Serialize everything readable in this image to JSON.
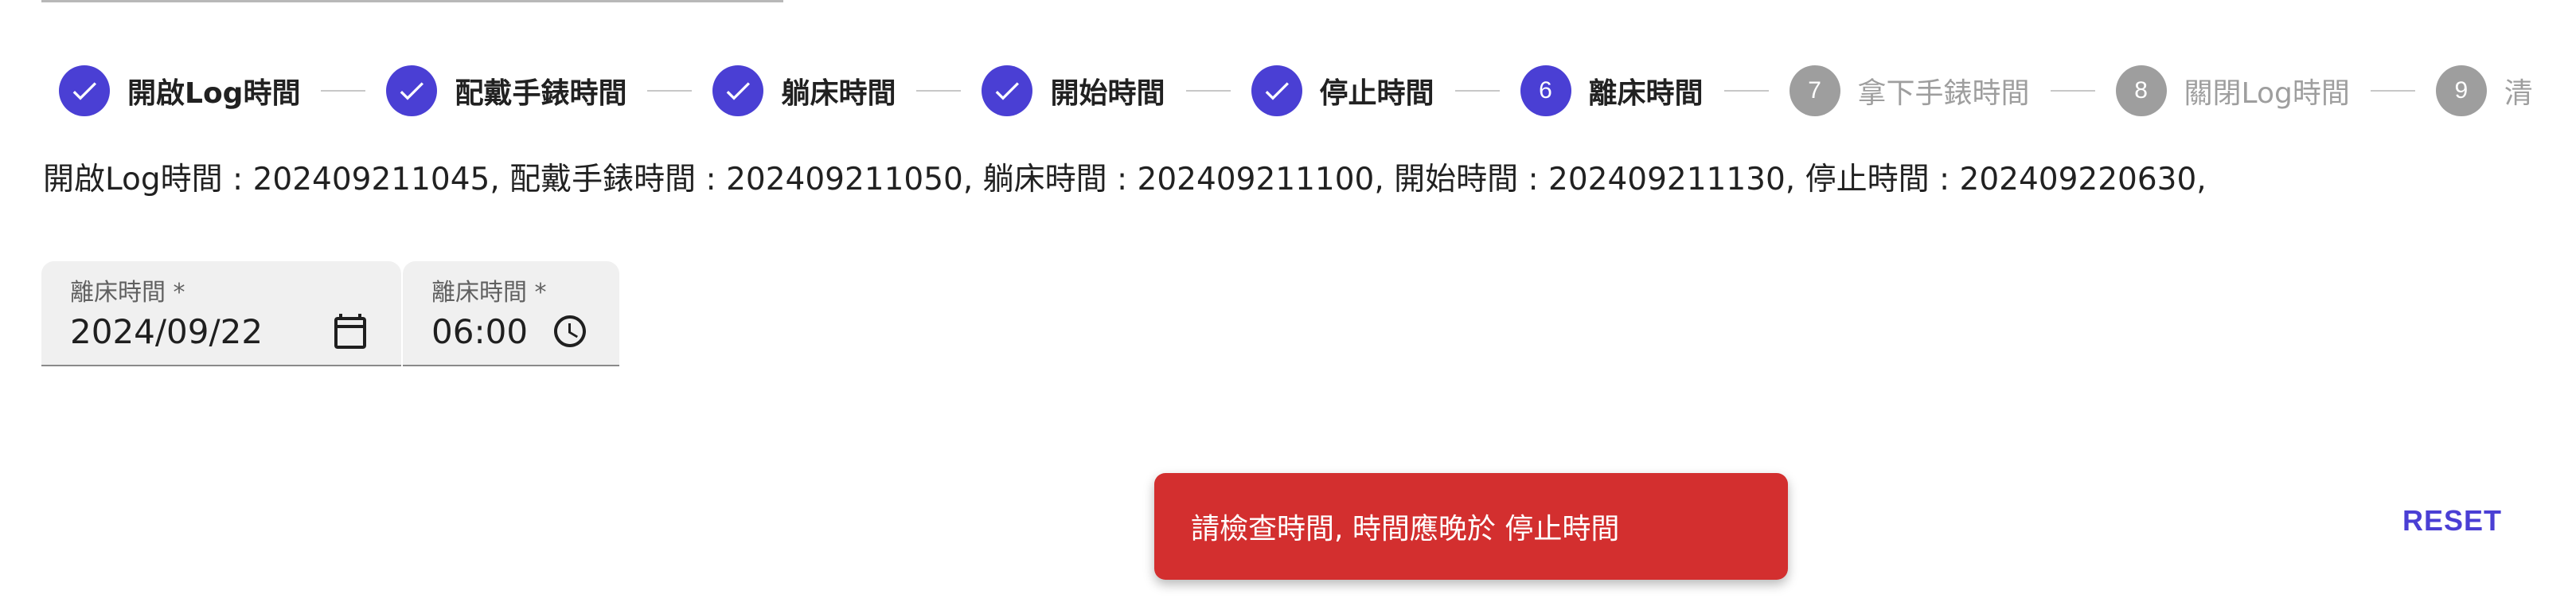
{
  "stepper": {
    "steps": [
      {
        "label": "開啟Log時間",
        "state": "completed",
        "icon": "check-icon"
      },
      {
        "label": "配戴手錶時間",
        "state": "completed",
        "icon": "check-icon"
      },
      {
        "label": "躺床時間",
        "state": "completed",
        "icon": "check-icon"
      },
      {
        "label": "開始時間",
        "state": "completed",
        "icon": "check-icon"
      },
      {
        "label": "停止時間",
        "state": "completed",
        "icon": "check-icon"
      },
      {
        "label": "離床時間",
        "state": "active",
        "number": "6"
      },
      {
        "label": "拿下手錶時間",
        "state": "pending",
        "number": "7"
      },
      {
        "label": "關閉Log時間",
        "state": "pending",
        "number": "8"
      },
      {
        "label": "清",
        "state": "pending",
        "number": "9"
      }
    ]
  },
  "summary": {
    "text": "開啟Log時間 : 202409211045, 配戴手錶時間 : 202409211050, 躺床時間 : 202409211100, 開始時間 : 202409211130, 停止時間 : 202409220630,"
  },
  "form": {
    "date_field": {
      "label": "離床時間 *",
      "value": "2024/09/22",
      "icon": "calendar-icon"
    },
    "time_field": {
      "label": "離床時間 *",
      "value": "06:00",
      "icon": "clock-icon"
    }
  },
  "snackbar": {
    "message": "請檢查時間, 時間應晚於 停止時間",
    "color": "#d32f2f"
  },
  "actions": {
    "reset_label": "RESET"
  },
  "colors": {
    "primary": "#4a3fd4",
    "pending": "#9e9e9e",
    "error": "#d32f2f"
  }
}
